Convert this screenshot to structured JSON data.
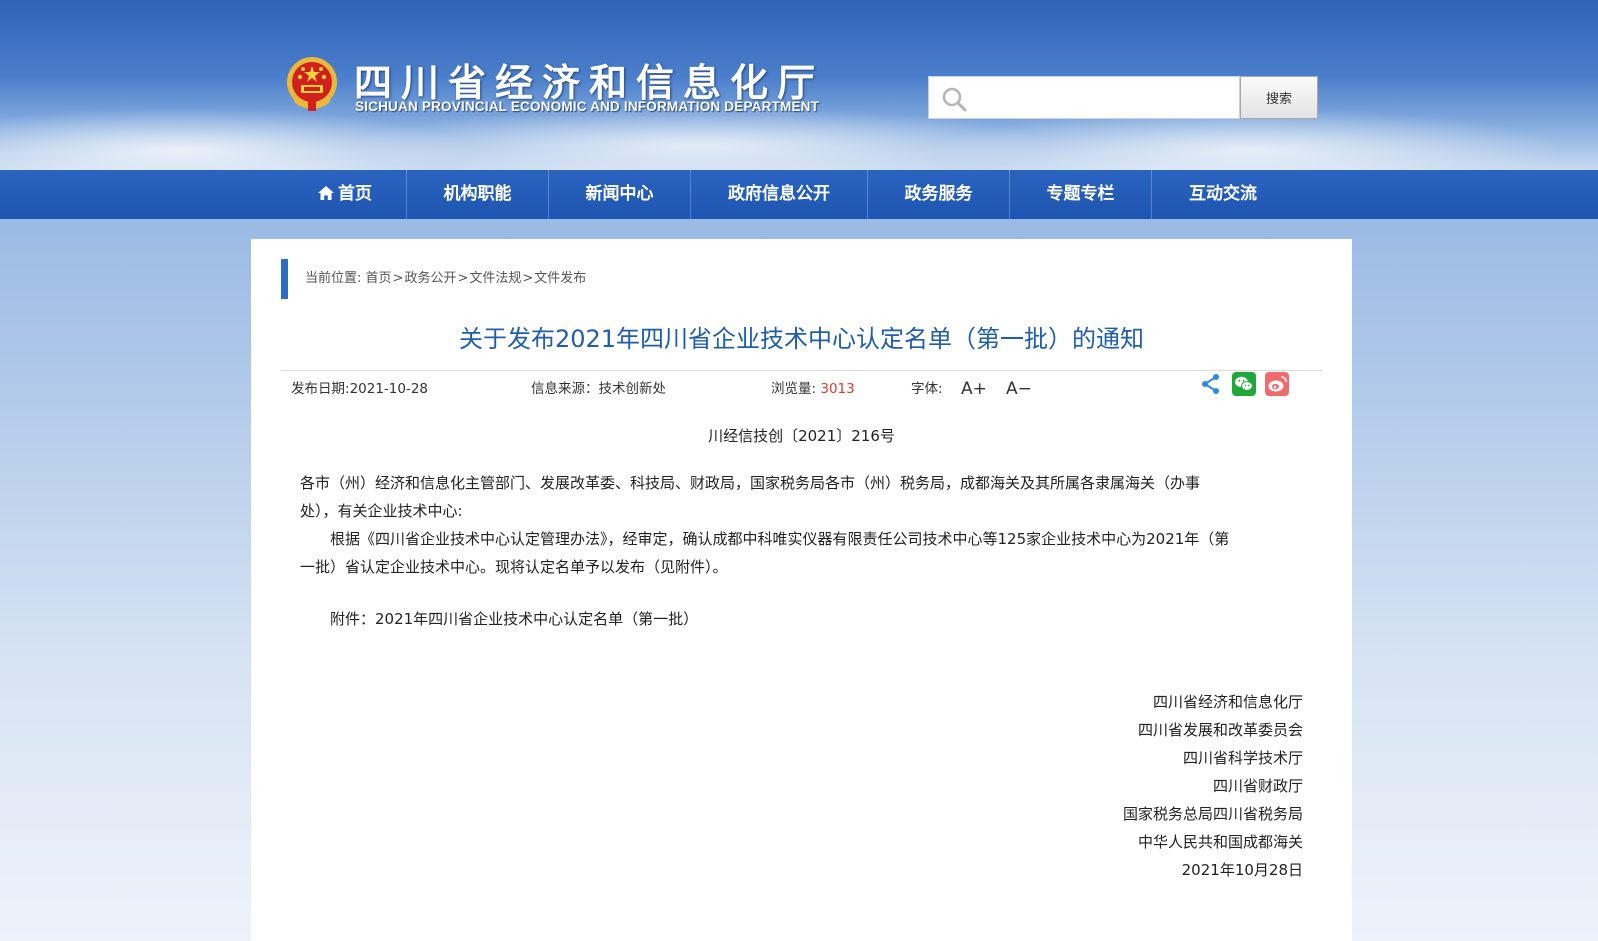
{
  "header": {
    "title": "四川省经济和信息化厅",
    "subtitle": "SICHUAN PROVINCIAL ECONOMIC AND INFORMATION DEPARTMENT",
    "search_placeholder": "",
    "search_button": "搜索"
  },
  "nav": {
    "items": [
      {
        "label": "首页",
        "icon": "home-icon"
      },
      {
        "label": "机构职能"
      },
      {
        "label": "新闻中心"
      },
      {
        "label": "政府信息公开"
      },
      {
        "label": "政务服务"
      },
      {
        "label": "专题专栏"
      },
      {
        "label": "互动交流"
      }
    ]
  },
  "breadcrumb": {
    "prefix": "当前位置:",
    "items": [
      "首页",
      "政务公开",
      "文件法规",
      "文件发布"
    ],
    "separator": ">"
  },
  "article": {
    "title": "关于发布2021年四川省企业技术中心认定名单（第一批）的通知",
    "publish_date_label": "发布日期:",
    "publish_date": "2021-10-28",
    "source_label": "信息来源：",
    "source": "技术创新处",
    "views_label": "浏览量:",
    "views": "3013",
    "font_label": "字体:",
    "font_increase": "A+",
    "font_decrease": "A−",
    "doc_number": "川经信技创〔2021〕216号",
    "paragraph1_line1": "各市（州）经济和信息化主管部门、发展改革委、科技局、财政局，国家税务局各市（州）税务局，成都海关及其所属各隶属海关（办事",
    "paragraph1_line2": "处），有关企业技术中心:",
    "paragraph2_line1": "根据《四川省企业技术中心认定管理办法》，经审定，确认成都中科唯实仪器有限责任公司技术中心等125家企业技术中心为2021年（第",
    "paragraph2_line2": "一批）省认定企业技术中心。现将认定名单予以发布（见附件）。",
    "attachment": "附件：2021年四川省企业技术中心认定名单（第一批）",
    "signatories": [
      "四川省经济和信息化厅",
      "四川省发展和改革委员会",
      "四川省科学技术厅",
      "四川省财政厅",
      "国家税务总局四川省税务局",
      "中华人民共和国成都海关"
    ],
    "sign_date": "2021年10月28日"
  },
  "share": {
    "icons": [
      "share-icon",
      "wechat-icon",
      "weibo-icon"
    ],
    "colors": {
      "share": "#2a8be0",
      "wechat": "#1ea83a",
      "weibo": "#f06b6b"
    }
  },
  "colors": {
    "nav_bg": "#1d55b1",
    "title": "#1f5eae",
    "accent_bar": "#2c6ec3",
    "views": "#e03a2e"
  }
}
